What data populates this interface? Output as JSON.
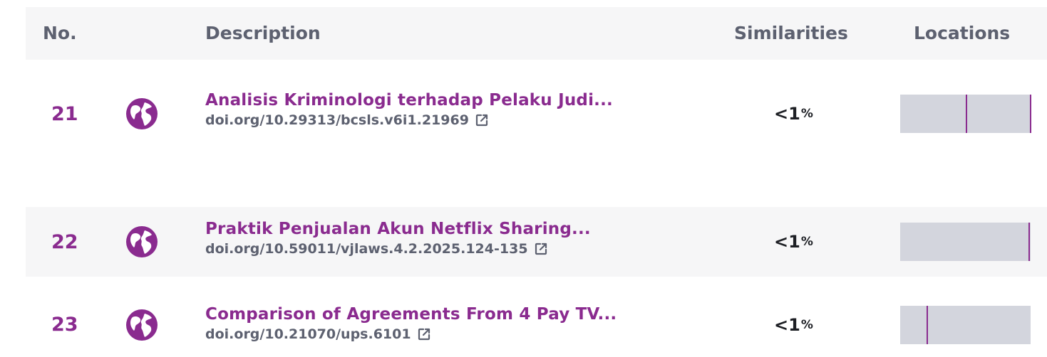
{
  "header": {
    "no": "No.",
    "description": "Description",
    "similarities": "Similarities",
    "locations": "Locations"
  },
  "colors": {
    "accent": "#8a2b8f",
    "header_bg": "#f6f6f7",
    "bar_bg": "#d3d5dd",
    "muted_text": "#5d6170"
  },
  "rows": [
    {
      "no": "21",
      "icon": "globe-icon",
      "title": "Analisis Kriminologi terhadap Pelaku Judi...",
      "link": "doi.org/10.29313/bcsls.v6i1.21969",
      "link_icon": "external-link-icon",
      "sim_main": "<1",
      "sim_unit": "%",
      "markers": [
        0.505,
        0.995
      ]
    },
    {
      "no": "22",
      "icon": "globe-icon",
      "title": "Praktik Penjualan Akun Netflix Sharing...",
      "link": "doi.org/10.59011/vjlaws.4.2.2025.124-135",
      "link_icon": "external-link-icon",
      "sim_main": "<1",
      "sim_unit": "%",
      "markers": [
        0.985
      ]
    },
    {
      "no": "23",
      "icon": "globe-icon",
      "title": "Comparison of Agreements From 4 Pay TV...",
      "link": "doi.org/10.21070/ups.6101",
      "link_icon": "external-link-icon",
      "sim_main": "<1",
      "sim_unit": "%",
      "markers": [
        0.2
      ]
    }
  ]
}
